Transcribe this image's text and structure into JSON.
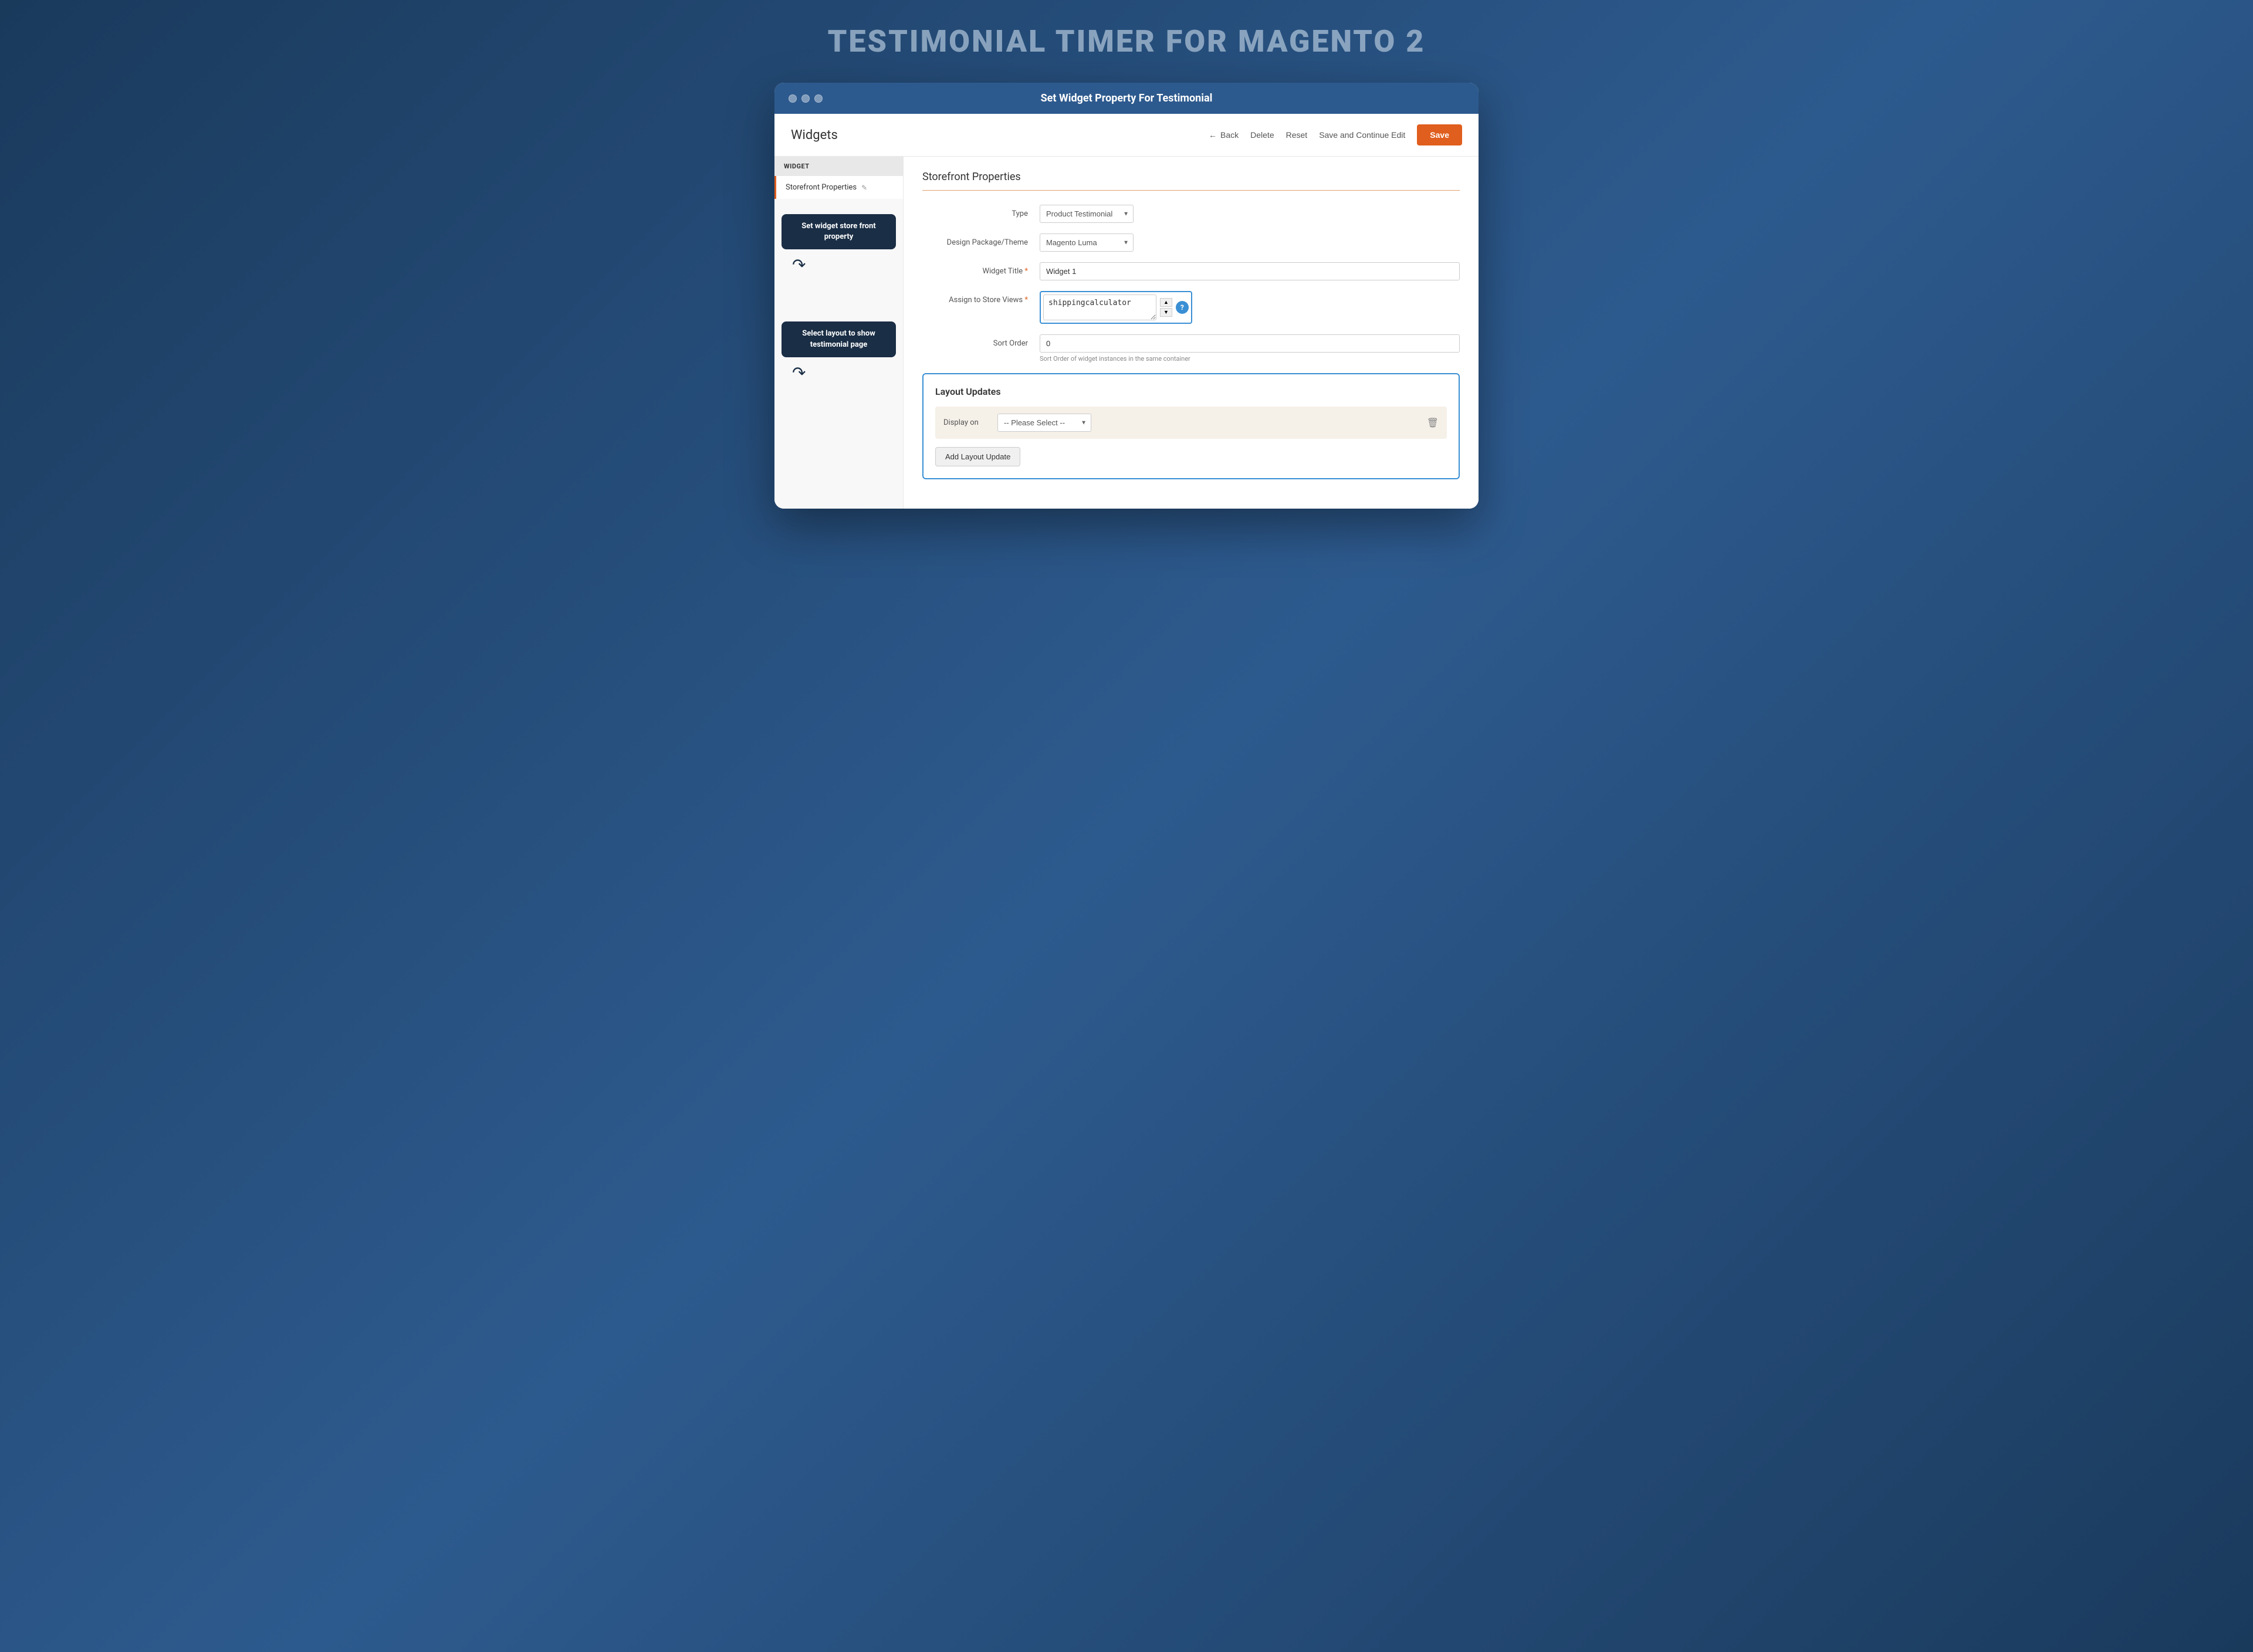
{
  "page": {
    "headline": "TESTIMONIAL TIMER FOR MAGENTO 2",
    "browser_title": "Set Widget Property For Testimonial"
  },
  "header": {
    "title": "Widgets",
    "back_label": "Back",
    "delete_label": "Delete",
    "reset_label": "Reset",
    "save_continue_label": "Save and Continue Edit",
    "save_label": "Save"
  },
  "sidebar": {
    "section_title": "WIDGET",
    "item_label": "Storefront Properties",
    "edit_icon": "✎"
  },
  "annotations": {
    "storefront_box": "Set widget store front property",
    "layout_box": "Select layout to show testimonial page"
  },
  "form": {
    "section_title": "Storefront Properties",
    "type_label": "Type",
    "type_value": "Product Testimonial",
    "design_label": "Design Package/Theme",
    "design_value": "Magento Luma",
    "widget_title_label": "Widget Title",
    "widget_title_value": "Widget 1",
    "store_views_label": "Assign to Store Views",
    "store_views_value": "shippingcalculator",
    "sort_order_label": "Sort Order",
    "sort_order_value": "0",
    "sort_order_hint": "Sort Order of widget instances in the same container",
    "layout_updates_title": "Layout Updates",
    "display_on_label": "Display on",
    "please_select": "-- Please Select --",
    "add_layout_label": "Add Layout Update",
    "help_icon_label": "?"
  },
  "icons": {
    "back_arrow": "←",
    "dropdown_arrow": "▼",
    "stepper_up": "▲",
    "stepper_down": "▼",
    "delete_bin": "🗑",
    "question_mark": "?"
  }
}
